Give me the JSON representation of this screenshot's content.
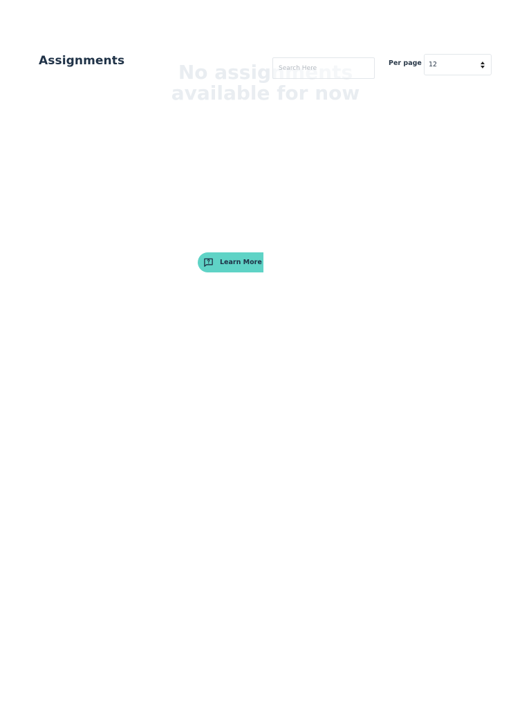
{
  "header": {
    "title": "Assignments"
  },
  "empty_state": {
    "line1": "No assignments",
    "line2": "available for now"
  },
  "search": {
    "placeholder": "Search Here",
    "value": ""
  },
  "pagination": {
    "per_page_label": "Per page",
    "per_page_value": "12"
  },
  "help": {
    "label": "Learn More",
    "icon": "question-chat-icon"
  },
  "colors": {
    "accent": "#5fd3c6",
    "title": "#1f3247",
    "empty_text": "#e9edf1"
  }
}
